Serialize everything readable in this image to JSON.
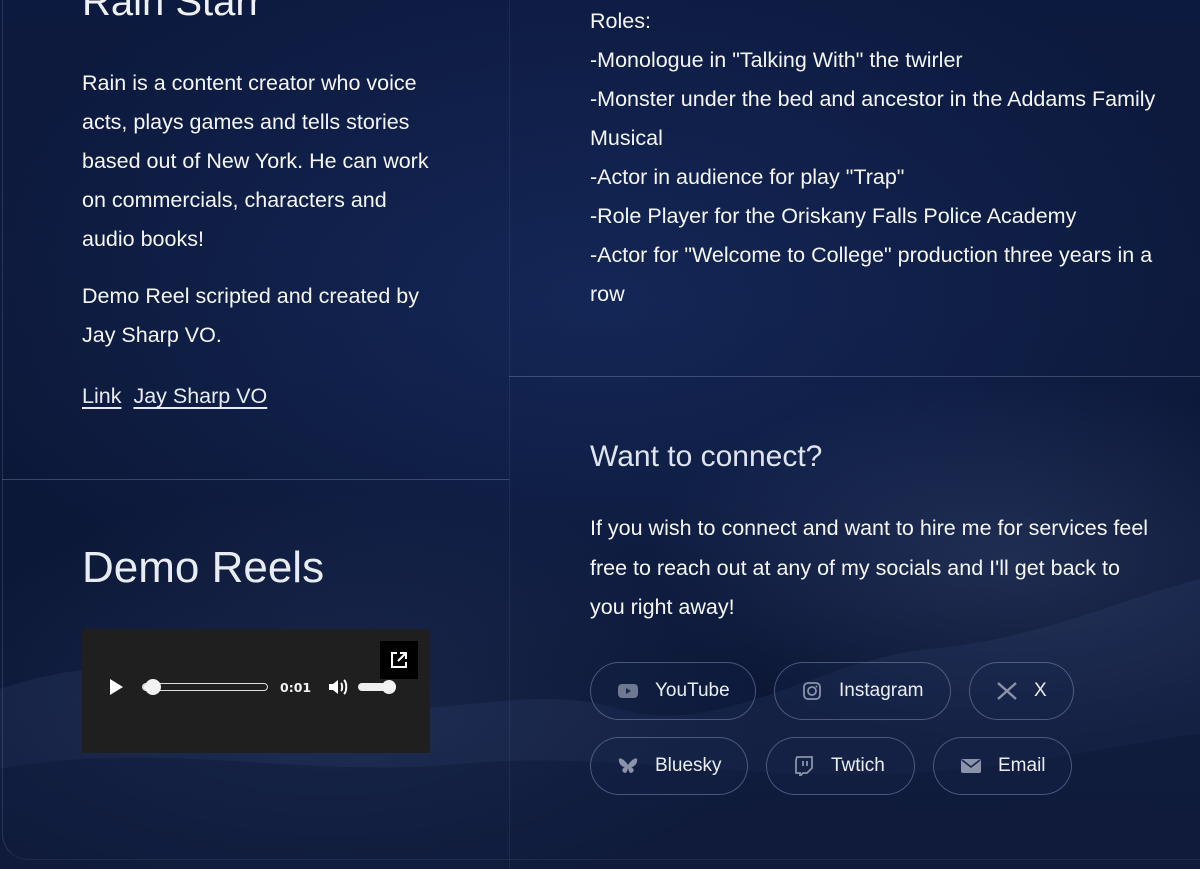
{
  "profile": {
    "name_heading": "Rain Starr",
    "bio": "Rain is a content creator who voice acts, plays games and tells stories based out of New York. He can work on commercials, characters and audio books!",
    "credit": "Demo Reel scripted and created by Jay Sharp VO.",
    "link_label": "Link",
    "link_name": "Jay Sharp VO"
  },
  "demo": {
    "heading": "Demo Reels",
    "player": {
      "current_time": "0:01",
      "progress": 0.02,
      "volume": 1.0
    }
  },
  "roles": {
    "lines": [
      "Roles:",
      "-Monologue in \"Talking With\" the twirler",
      "-Monster under the bed and ancestor in the Addams Family Musical",
      "-Actor in audience for play \"Trap\"",
      "-Role Player for the Oriskany Falls Police Academy",
      "-Actor for \"Welcome to College\" production three years in a row"
    ]
  },
  "connect": {
    "heading": "Want to connect?",
    "text": "If you wish to connect and want to hire me for services feel free to reach out at any of my socials and I'll get back to you right away!",
    "socials": [
      {
        "label": "YouTube",
        "icon": "youtube-icon"
      },
      {
        "label": "Instagram",
        "icon": "instagram-icon"
      },
      {
        "label": "X",
        "icon": "x-icon"
      },
      {
        "label": "Bluesky",
        "icon": "bluesky-icon"
      },
      {
        "label": "Twtich",
        "icon": "twitch-icon"
      },
      {
        "label": "Email",
        "icon": "email-icon"
      }
    ]
  }
}
